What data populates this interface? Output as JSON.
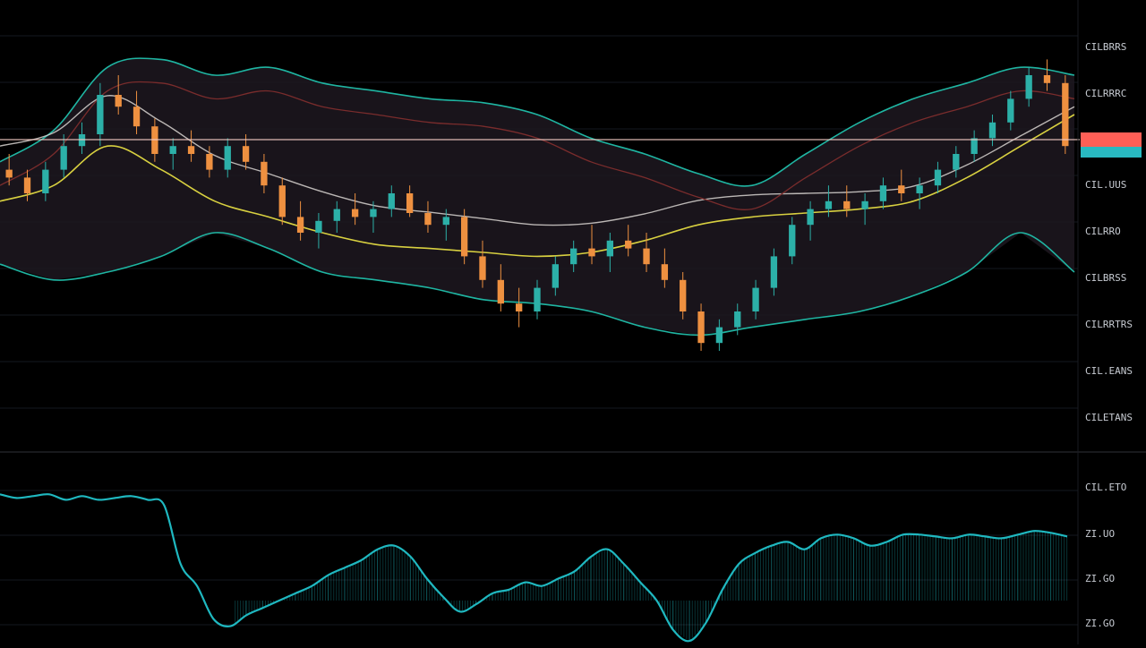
{
  "colors": {
    "background": "#000000",
    "grid": "#151820",
    "bull": "#2cb0a8",
    "bear": "#ee9040",
    "teal_band": "#1fb5a2",
    "white_line": "#d8d4d0",
    "yellow_line": "#d8d040",
    "dark_red_line": "#7a2c2c",
    "orange_line": "#e07a3a",
    "price_line": "#f3cbc3",
    "price_tag": "#ff5f56",
    "price_tag_secondary": "#29b9c1",
    "cloud": "#1d1820",
    "oscillator": "#1fb8c0",
    "axis_text": "#c7cbd2",
    "separator": "#2f3238"
  },
  "price_axis": {
    "labels": [
      "CILBRRS",
      "CILRRRC",
      "CIL.UUS",
      "CILRRO",
      "CILBRSS",
      "CILRRTRS",
      "CIL.EANS",
      "CILETANS"
    ]
  },
  "oscillator_axis": {
    "labels": [
      "CIL.ETO",
      "ZI.UO",
      "ZI.GO",
      "ZI.GO"
    ]
  },
  "chart_data": {
    "type": "line",
    "title": "",
    "xlabel": "",
    "ylabel": "",
    "ylim": [
      0,
      100
    ],
    "x": [
      0,
      10,
      20,
      30,
      40,
      50,
      60,
      70,
      80,
      90,
      100,
      110,
      120,
      130,
      140,
      150,
      160,
      170,
      180,
      190,
      200
    ],
    "series": [
      {
        "role": "candles",
        "ohlc": [
          [
            66,
            70,
            62,
            64
          ],
          [
            64,
            66,
            58,
            60
          ],
          [
            60,
            68,
            58,
            66
          ],
          [
            66,
            75,
            64,
            72
          ],
          [
            72,
            78,
            70,
            75
          ],
          [
            75,
            88,
            72,
            85
          ],
          [
            85,
            90,
            80,
            82
          ],
          [
            82,
            86,
            75,
            77
          ],
          [
            77,
            79,
            68,
            70
          ],
          [
            70,
            74,
            66,
            72
          ],
          [
            72,
            76,
            68,
            70
          ],
          [
            70,
            72,
            64,
            66
          ],
          [
            66,
            74,
            64,
            72
          ],
          [
            72,
            75,
            66,
            68
          ],
          [
            68,
            70,
            60,
            62
          ],
          [
            62,
            64,
            52,
            54
          ],
          [
            54,
            58,
            48,
            50
          ],
          [
            50,
            55,
            46,
            53
          ],
          [
            53,
            58,
            50,
            56
          ],
          [
            56,
            60,
            52,
            54
          ],
          [
            54,
            58,
            50,
            56
          ],
          [
            56,
            62,
            54,
            60
          ],
          [
            60,
            62,
            54,
            55
          ],
          [
            55,
            58,
            50,
            52
          ],
          [
            52,
            56,
            48,
            54
          ],
          [
            54,
            56,
            42,
            44
          ],
          [
            44,
            48,
            36,
            38
          ],
          [
            38,
            42,
            30,
            32
          ],
          [
            32,
            36,
            26,
            30
          ],
          [
            30,
            38,
            28,
            36
          ],
          [
            36,
            44,
            34,
            42
          ],
          [
            42,
            48,
            40,
            46
          ],
          [
            46,
            52,
            42,
            44
          ],
          [
            44,
            50,
            40,
            48
          ],
          [
            48,
            52,
            44,
            46
          ],
          [
            46,
            50,
            40,
            42
          ],
          [
            42,
            46,
            36,
            38
          ],
          [
            38,
            40,
            28,
            30
          ],
          [
            30,
            32,
            20,
            22
          ],
          [
            22,
            28,
            20,
            26
          ],
          [
            26,
            32,
            24,
            30
          ],
          [
            30,
            38,
            28,
            36
          ],
          [
            36,
            46,
            34,
            44
          ],
          [
            44,
            54,
            42,
            52
          ],
          [
            52,
            58,
            48,
            56
          ],
          [
            56,
            62,
            54,
            58
          ],
          [
            58,
            62,
            54,
            56
          ],
          [
            56,
            60,
            52,
            58
          ],
          [
            58,
            64,
            56,
            62
          ],
          [
            62,
            66,
            58,
            60
          ],
          [
            60,
            64,
            56,
            62
          ],
          [
            62,
            68,
            60,
            66
          ],
          [
            66,
            72,
            64,
            70
          ],
          [
            70,
            76,
            68,
            74
          ],
          [
            74,
            80,
            72,
            78
          ],
          [
            78,
            86,
            76,
            84
          ],
          [
            84,
            92,
            82,
            90
          ],
          [
            90,
            94,
            86,
            88
          ],
          [
            88,
            90,
            70,
            72
          ]
        ]
      },
      {
        "name": "",
        "values": [
          58,
          62,
          72,
          66,
          58,
          54,
          50,
          47,
          46,
          45,
          44,
          45,
          48,
          52,
          54,
          55,
          56,
          58,
          64,
          72,
          80
        ]
      },
      {
        "name": "",
        "values": [
          68,
          76,
          92,
          94,
          90,
          92,
          88,
          86,
          84,
          83,
          80,
          74,
          70,
          65,
          62,
          70,
          78,
          84,
          88,
          92,
          90
        ]
      },
      {
        "name": "",
        "values": [
          42,
          38,
          40,
          44,
          50,
          46,
          40,
          38,
          36,
          33,
          32,
          30,
          26,
          24,
          26,
          28,
          30,
          34,
          40,
          50,
          40
        ]
      }
    ]
  },
  "oscillator": {
    "values": [
      58,
      56,
      57,
      58,
      55,
      57,
      55,
      56,
      57,
      55,
      52,
      20,
      8,
      -10,
      -14,
      -8,
      -4,
      0,
      4,
      8,
      14,
      18,
      22,
      28,
      30,
      24,
      12,
      2,
      -6,
      -2,
      4,
      6,
      10,
      8,
      12,
      16,
      24,
      28,
      20,
      10,
      0,
      -16,
      -22,
      -12,
      6,
      20,
      26,
      30,
      32,
      28,
      34,
      36,
      34,
      30,
      32,
      36,
      36,
      35,
      34,
      36,
      35,
      34,
      36,
      38,
      37,
      35
    ]
  }
}
